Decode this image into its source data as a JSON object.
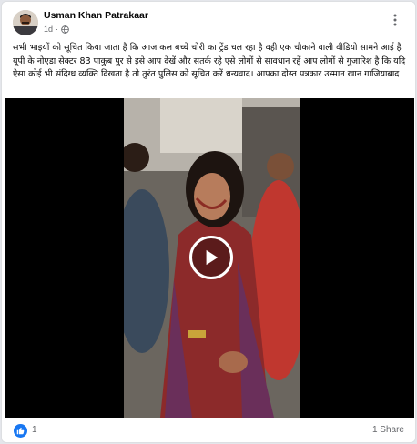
{
  "post": {
    "author": "Usman Khan Patrakaar",
    "time": "1d",
    "privacy_icon": "globe-icon",
    "more_icon": "more-options-icon",
    "text": "सभी भाइयों को सूचित किया जाता है कि आज कल बच्चे चोरी का ट्रेंड चल रहा है वही एक चौकाने वाली वीडियो सामने आई है यूपी के नोएडा सेक्टर 83 पाकुब पुर से इसे आप देखें और सतर्क रहे एसे लोगों से सावधान रहें आप लोगों से गुजारिश है कि यदि ऐसा कोई भी संदिग्ध व्यक्ति दिखता है तो तुरंत पुलिस को सूचित करें धन्यवाद। आपका दोस्त पत्रकार उस्मान खान गाजियाबाद"
  },
  "video": {
    "play_icon": "play-icon"
  },
  "footer": {
    "reaction_icon": "like-icon",
    "reaction_count": "1",
    "shares": "1 Share"
  },
  "colors": {
    "brand_blue": "#1877f2",
    "secondary_text": "#65676b",
    "card_bg": "#ffffff"
  }
}
